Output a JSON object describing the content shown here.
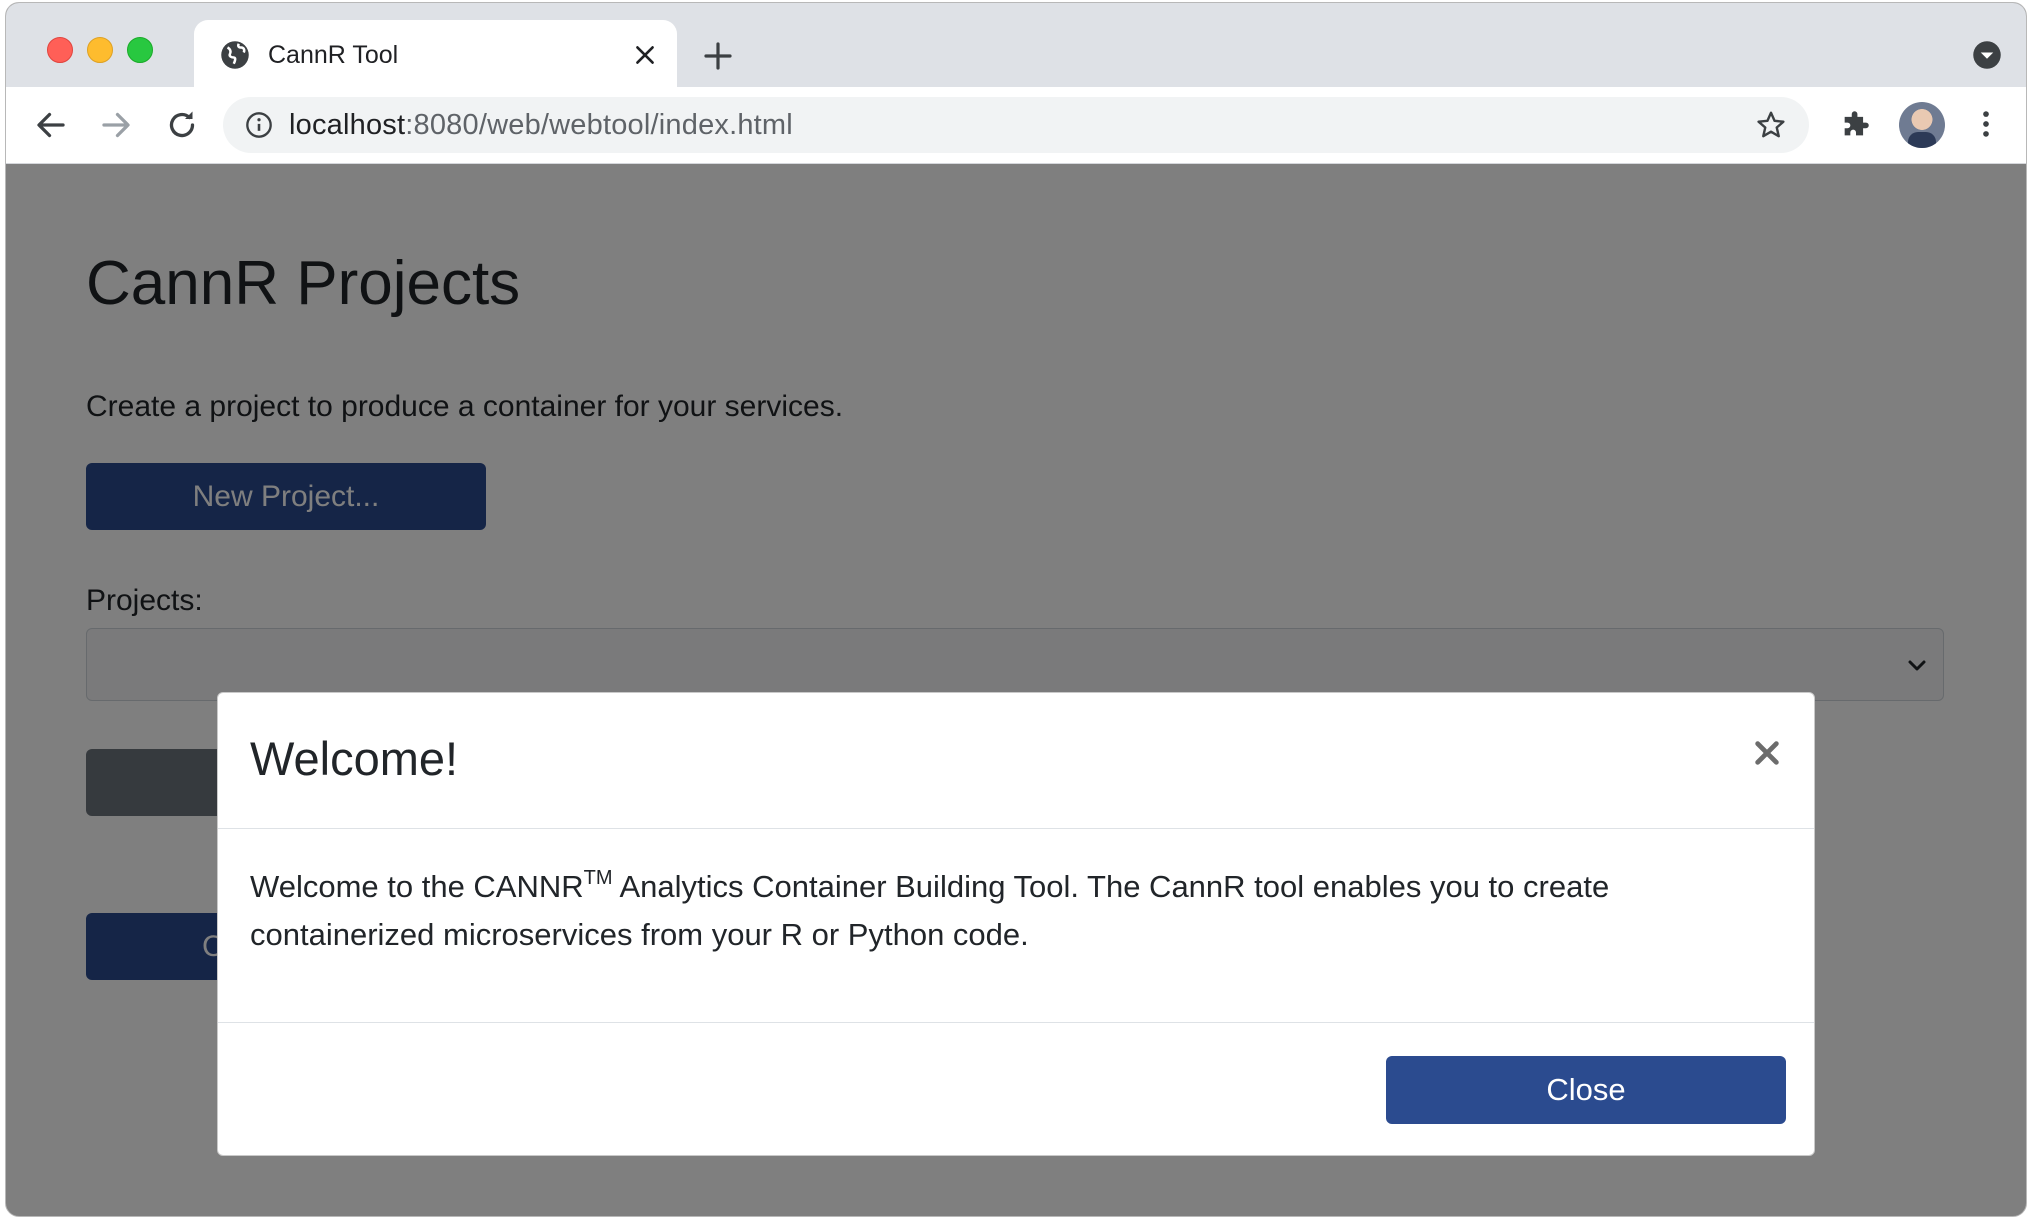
{
  "browser": {
    "tab_title": "CannR Tool",
    "url_host": "localhost",
    "url_rest": ":8080/web/webtool/index.html"
  },
  "page": {
    "title": "CannR Projects",
    "intro": "Create a project to produce a container for your services.",
    "new_project_button": "New Project...",
    "projects_label": "Projects:",
    "projects_selected": "",
    "partial_button_label": "C"
  },
  "modal": {
    "title": "Welcome!",
    "body_before": "Welcome to the CANNR",
    "body_sup": "TM",
    "body_after": " Analytics Container Building Tool. The CannR tool enables you to create containerized microservices from your R or Python code.",
    "close_button": "Close"
  },
  "colors": {
    "primary_button": "#2b4b8f",
    "overlay": "rgba(0,0,0,0.5)"
  },
  "icons": [
    "globe-icon",
    "close-icon",
    "plus-icon",
    "back-icon",
    "forward-icon",
    "reload-icon",
    "info-icon",
    "star-icon",
    "puzzle-icon",
    "kebab-menu-icon",
    "chevron-down-icon"
  ]
}
